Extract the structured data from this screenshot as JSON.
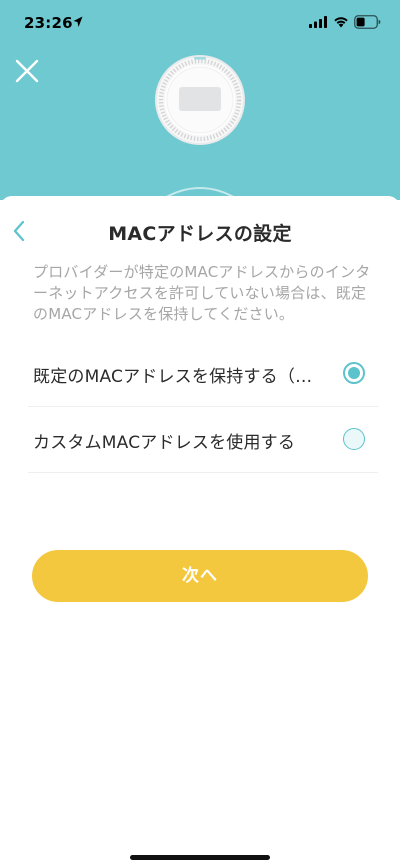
{
  "status_bar": {
    "time": "23:26"
  },
  "header": {
    "title": "MACアドレスの設定"
  },
  "description": "プロバイダーが特定のMACアドレスからのインターネットアクセスを許可していない場合は、既定のMACアドレスを保持してください。",
  "options": [
    {
      "label": "既定のMACアドレスを保持する（既定）",
      "selected": true
    },
    {
      "label": "カスタムMACアドレスを使用する",
      "selected": false
    }
  ],
  "next_button": {
    "label": "次へ"
  },
  "colors": {
    "header_background": "#6fc9d1",
    "accent": "#5cc2cb",
    "button": "#f4c83e",
    "title_text": "#2b2b2b",
    "description_text": "#a6a6a6"
  },
  "icons": {
    "close": "close-icon",
    "back": "chevron-left-icon",
    "location": "location-arrow-icon",
    "signal": "cellular-signal-icon",
    "wifi": "wifi-icon",
    "battery": "battery-icon"
  }
}
